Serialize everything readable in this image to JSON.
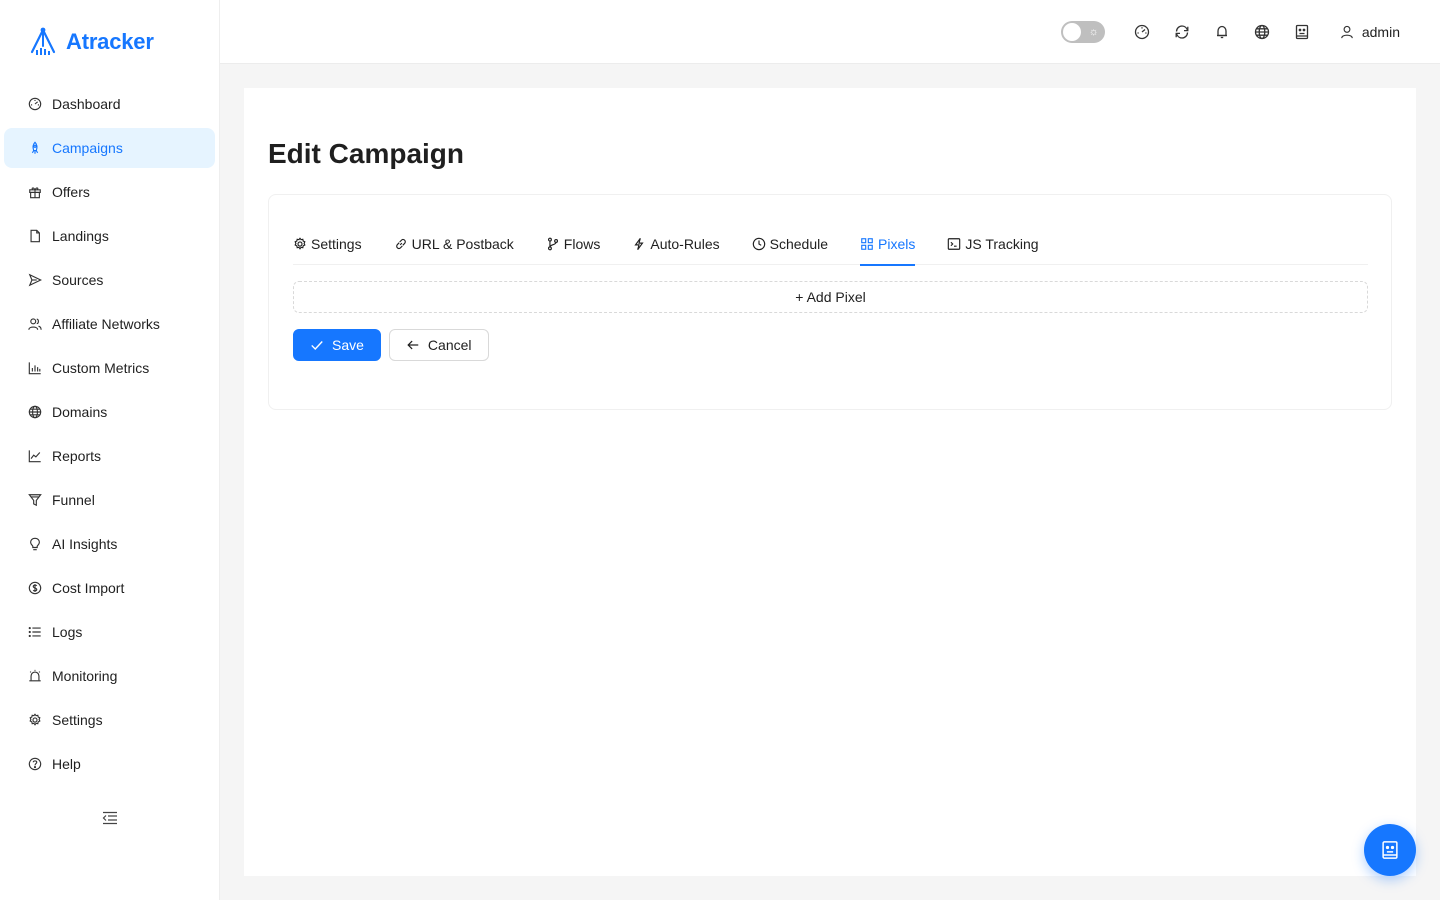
{
  "app": {
    "name": "Atracker",
    "accent": "#1677ff"
  },
  "sidebar": {
    "items": [
      {
        "label": "Dashboard",
        "icon": "dashboard-icon",
        "active": false
      },
      {
        "label": "Campaigns",
        "icon": "rocket-icon",
        "active": true
      },
      {
        "label": "Offers",
        "icon": "gift-icon",
        "active": false
      },
      {
        "label": "Landings",
        "icon": "file-icon",
        "active": false
      },
      {
        "label": "Sources",
        "icon": "send-icon",
        "active": false
      },
      {
        "label": "Affiliate Networks",
        "icon": "team-icon",
        "active": false
      },
      {
        "label": "Custom Metrics",
        "icon": "bar-chart-icon",
        "active": false
      },
      {
        "label": "Domains",
        "icon": "globe-icon",
        "active": false
      },
      {
        "label": "Reports",
        "icon": "line-chart-icon",
        "active": false
      },
      {
        "label": "Funnel",
        "icon": "funnel-icon",
        "active": false
      },
      {
        "label": "AI Insights",
        "icon": "bulb-icon",
        "active": false
      },
      {
        "label": "Cost Import",
        "icon": "dollar-icon",
        "active": false
      },
      {
        "label": "Logs",
        "icon": "list-icon",
        "active": false
      },
      {
        "label": "Monitoring",
        "icon": "alarm-icon",
        "active": false
      },
      {
        "label": "Settings",
        "icon": "gear-icon",
        "active": false
      },
      {
        "label": "Help",
        "icon": "question-icon",
        "active": false
      }
    ]
  },
  "header": {
    "user_name": "admin",
    "theme_toggle_on": false
  },
  "main": {
    "title": "Edit Campaign",
    "tabs": [
      {
        "label": "Settings",
        "icon": "gear-icon",
        "active": false
      },
      {
        "label": "URL & Postback",
        "icon": "link-icon",
        "active": false
      },
      {
        "label": "Flows",
        "icon": "branch-icon",
        "active": false
      },
      {
        "label": "Auto-Rules",
        "icon": "thunderbolt-icon",
        "active": false
      },
      {
        "label": "Schedule",
        "icon": "clock-icon",
        "active": false
      },
      {
        "label": "Pixels",
        "icon": "appstore-icon",
        "active": true
      },
      {
        "label": "JS Tracking",
        "icon": "code-icon",
        "active": false
      }
    ],
    "add_pixel_label": "+ Add Pixel",
    "save_label": "Save",
    "cancel_label": "Cancel"
  }
}
